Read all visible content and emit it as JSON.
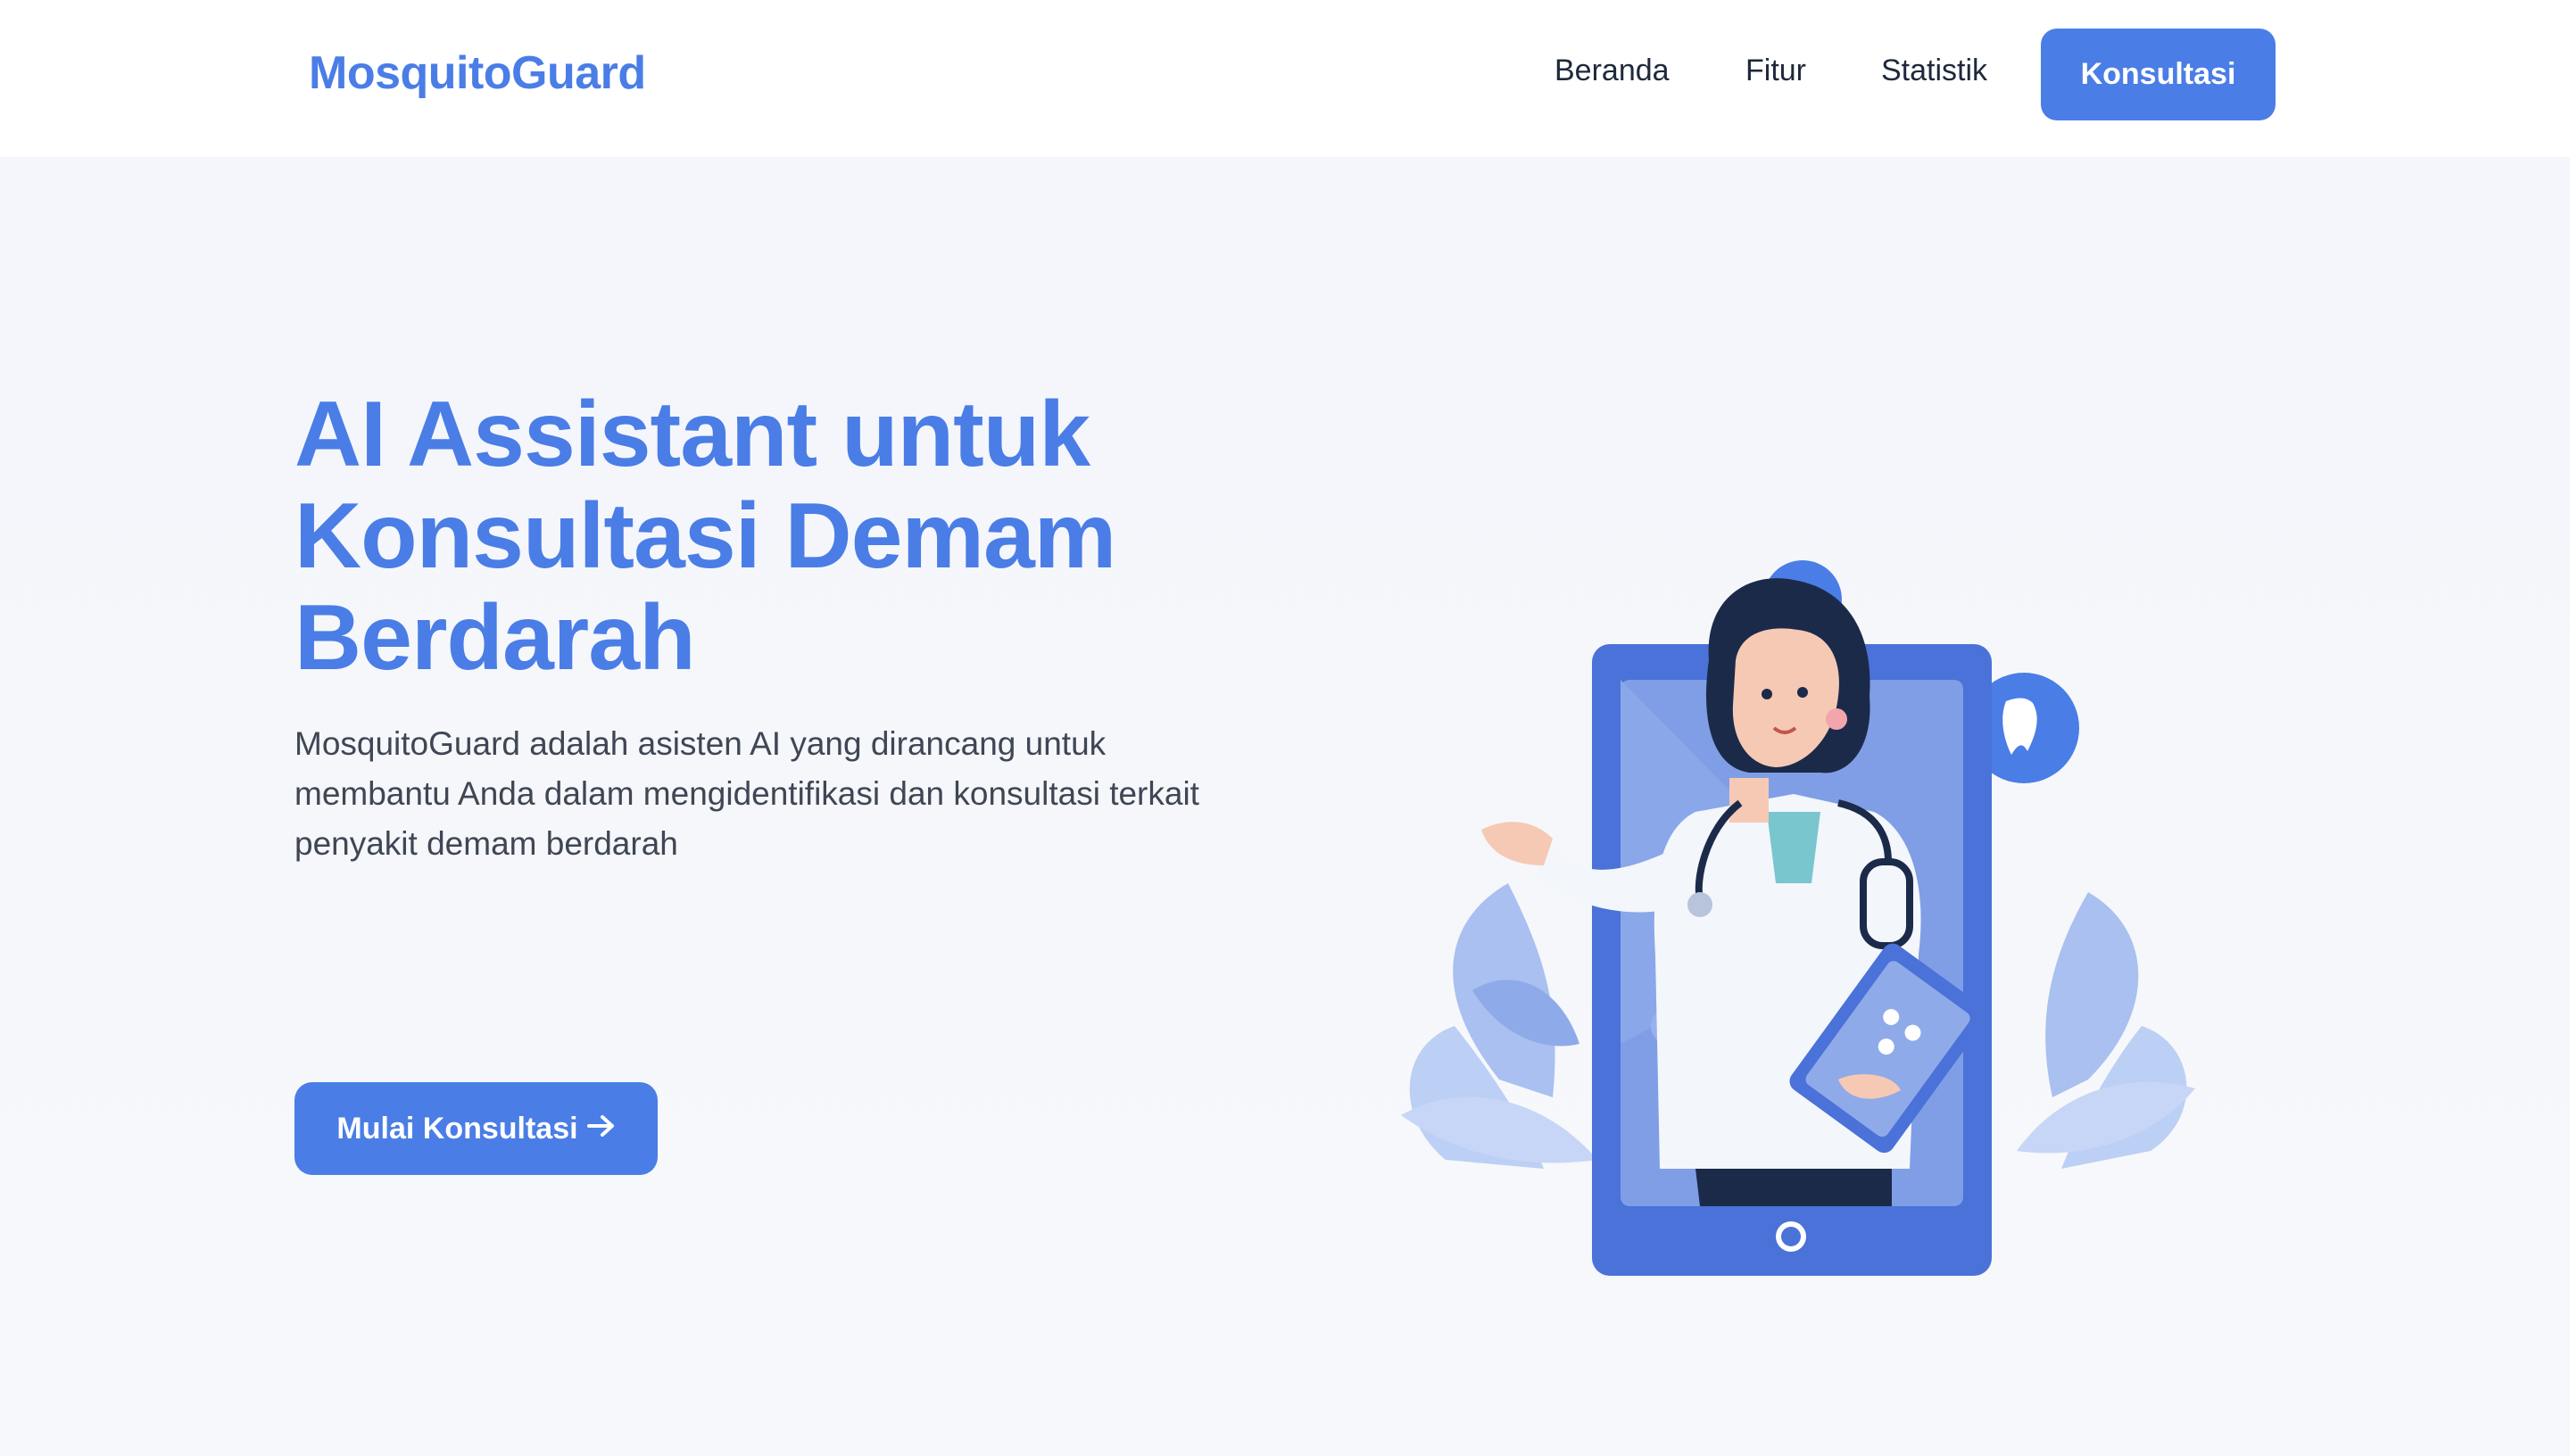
{
  "navbar": {
    "logo": "MosquitoGuard",
    "links": [
      "Beranda",
      "Fitur",
      "Statistik"
    ],
    "cta_label": "Konsultasi"
  },
  "hero": {
    "headline_lines": [
      "AI Assistant untuk",
      "Konsultasi Demam",
      "Berdarah"
    ],
    "description_lines": [
      "MosquitoGuard adalah asisten AI yang dirancang untuk",
      "membantu Anda dalam mengidentifikasi dan konsultasi terkait",
      "penyakit demam berdarah"
    ],
    "cta_label": "Mulai Konsultasi",
    "cta_icon": "arrow-right-icon"
  },
  "colors": {
    "primary": "#4a7de6",
    "text_dark": "#1e293b",
    "text_body": "#3f4654",
    "background": "#f5f7fb"
  }
}
